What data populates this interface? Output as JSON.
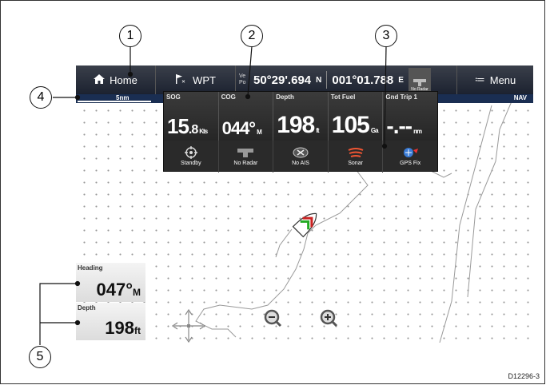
{
  "topbar": {
    "home_label": "Home",
    "wpt_label": "WPT",
    "pos_small_1": "Ve",
    "pos_small_2": "Po",
    "latitude": "50°29'.694",
    "lat_hem": "N",
    "longitude": "001°01.788",
    "lon_hem": "E",
    "radar_label": "No Radar",
    "menu_label": "Menu"
  },
  "scale": {
    "range_label": "5nm",
    "mode_label": "NAV"
  },
  "panel": {
    "cells": [
      {
        "label": "SOG",
        "value": "15",
        "decimal": ".8",
        "unit": "Kts"
      },
      {
        "label": "COG",
        "value": "044°",
        "unit": "M"
      },
      {
        "label": "Depth",
        "value": "198",
        "unit": "ft"
      },
      {
        "label": "Tot Fuel",
        "value": "105",
        "unit": "Ga"
      },
      {
        "label": "Gnd Trip 1",
        "value": "-.--",
        "unit": "nm"
      }
    ],
    "status": [
      {
        "label": "Standby",
        "icon": "autopilot-icon"
      },
      {
        "label": "No Radar",
        "icon": "radar-icon"
      },
      {
        "label": "No AIS",
        "icon": "ais-icon"
      },
      {
        "label": "Sonar",
        "icon": "sonar-icon"
      },
      {
        "label": "GPS Fix",
        "icon": "gps-icon"
      }
    ]
  },
  "tiles": {
    "heading": {
      "label": "Heading",
      "value": "047°",
      "unit": "M"
    },
    "depth": {
      "label": "Depth",
      "value": "198",
      "unit": "ft"
    }
  },
  "callouts": [
    "1",
    "2",
    "3",
    "4",
    "5"
  ],
  "doc_id": "D12296-3"
}
